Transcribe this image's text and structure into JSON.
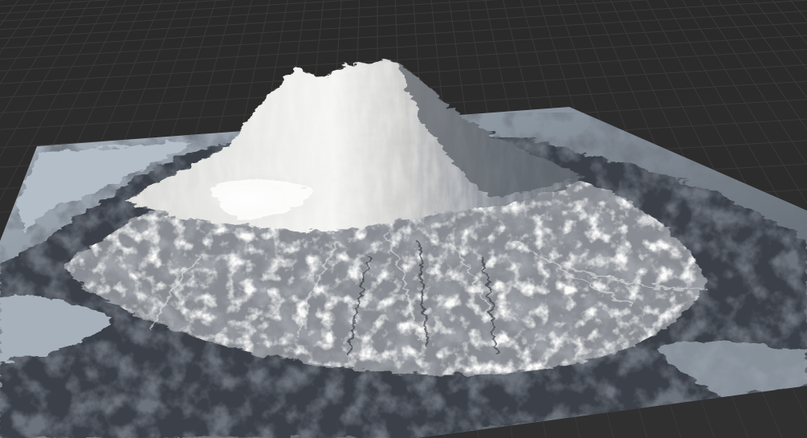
{
  "viewport": {
    "background_color": "#2c2c2c",
    "grid_line_color": "#3a3a3a",
    "show_grid": true
  },
  "terrain": {
    "type": "mountain-heightfield",
    "base_color": "#a9b3bd",
    "lowland_color": "#3a3f46",
    "snow_color": "#f2f2f0",
    "shadow_color": "#20242a"
  }
}
